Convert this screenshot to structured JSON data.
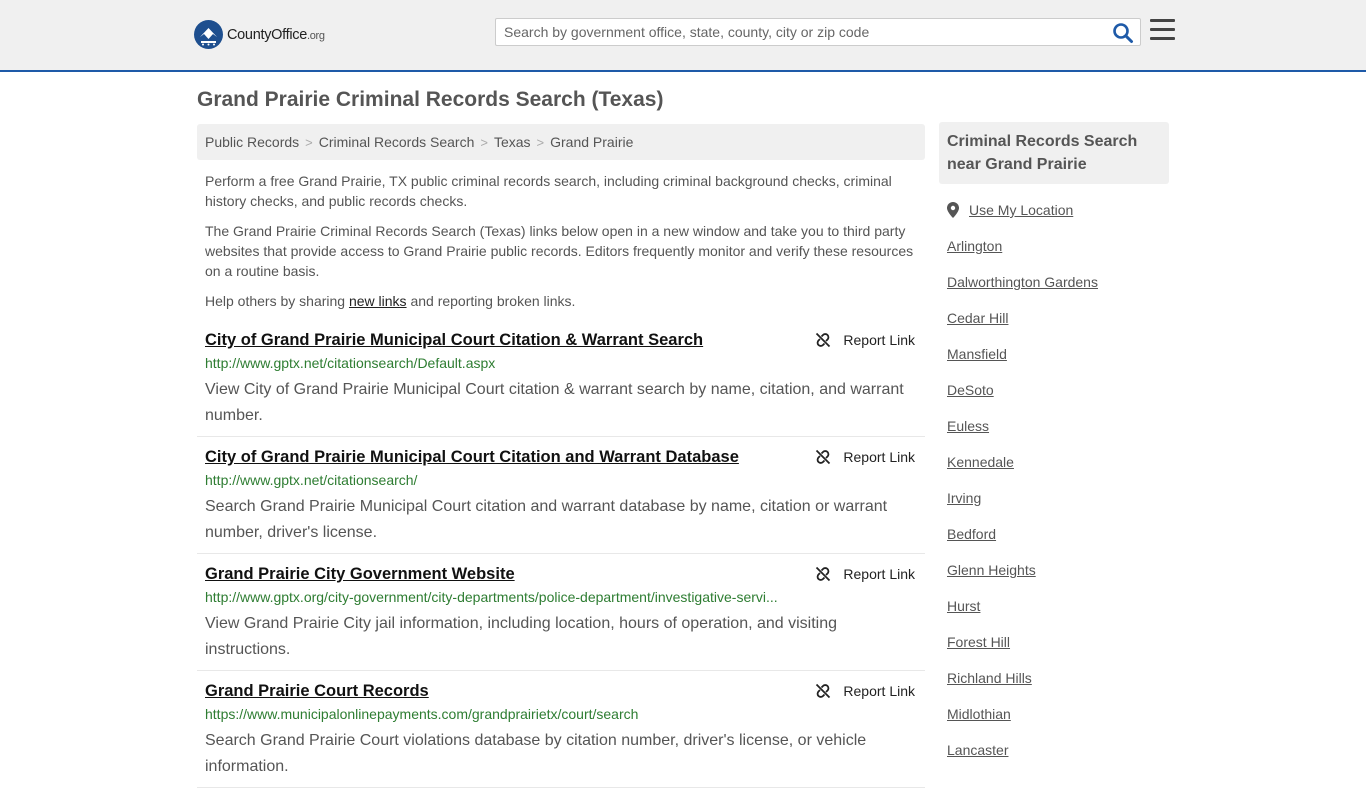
{
  "header": {
    "logo_name": "CountyOffice",
    "logo_tld": ".org",
    "search_placeholder": "Search by government office, state, county, city or zip code"
  },
  "page": {
    "title": "Grand Prairie Criminal Records Search (Texas)"
  },
  "breadcrumb": [
    "Public Records",
    "Criminal Records Search",
    "Texas",
    "Grand Prairie"
  ],
  "intro": {
    "p1": "Perform a free Grand Prairie, TX public criminal records search, including criminal background checks, criminal history checks, and public records checks.",
    "p2": "The Grand Prairie Criminal Records Search (Texas) links below open in a new window and take you to third party websites that provide access to Grand Prairie public records. Editors frequently monitor and verify these resources on a routine basis.",
    "p3_before": "Help others by sharing ",
    "p3_link": "new links",
    "p3_after": " and reporting broken links."
  },
  "report_label": "Report Link",
  "results": [
    {
      "title": "City of Grand Prairie Municipal Court Citation & Warrant Search",
      "url": "http://www.gptx.net/citationsearch/Default.aspx",
      "desc": "View City of Grand Prairie Municipal Court citation & warrant search by name, citation, and warrant number."
    },
    {
      "title": "City of Grand Prairie Municipal Court Citation and Warrant Database",
      "url": "http://www.gptx.net/citationsearch/",
      "desc": "Search Grand Prairie Municipal Court citation and warrant database by name, citation or warrant number, driver's license."
    },
    {
      "title": "Grand Prairie City Government Website",
      "url": "http://www.gptx.org/city-government/city-departments/police-department/investigative-servi...",
      "desc": "View Grand Prairie City jail information, including location, hours of operation, and visiting instructions."
    },
    {
      "title": "Grand Prairie Court Records",
      "url": "https://www.municipalonlinepayments.com/grandprairietx/court/search",
      "desc": "Search Grand Prairie Court violations database by citation number, driver's license, or vehicle information."
    }
  ],
  "sidebar": {
    "heading": "Criminal Records Search near Grand Prairie",
    "use_location": "Use My Location",
    "cities": [
      "Arlington",
      "Dalworthington Gardens",
      "Cedar Hill",
      "Mansfield",
      "DeSoto",
      "Euless",
      "Kennedale",
      "Irving",
      "Bedford",
      "Glenn Heights",
      "Hurst",
      "Forest Hill",
      "Richland Hills",
      "Midlothian",
      "Lancaster"
    ]
  },
  "colors": {
    "accent": "#1e5aa8",
    "url_green": "#2e7d32",
    "header_bg": "#f0f0f0"
  }
}
